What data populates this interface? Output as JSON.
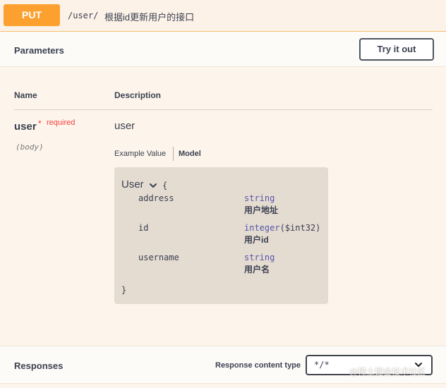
{
  "operation": {
    "method": "PUT",
    "path": "/user/",
    "summary": "根据id更新用户的接口"
  },
  "parameters": {
    "title": "Parameters",
    "try_button": "Try it out",
    "col_name": "Name",
    "col_description": "Description",
    "param": {
      "name": "user",
      "required_star": "*",
      "required_label": "required",
      "location": "(body)",
      "description": "user",
      "tab_example": "Example Value",
      "tab_model": "Model"
    }
  },
  "model": {
    "name": "User",
    "open_brace": "{",
    "close_brace": "}",
    "properties": [
      {
        "name": "address",
        "type": "string",
        "format": "",
        "description": "用户地址"
      },
      {
        "name": "id",
        "type": "integer",
        "format": "($int32)",
        "description": "用户id"
      },
      {
        "name": "username",
        "type": "string",
        "format": "",
        "description": "用户名"
      }
    ]
  },
  "responses": {
    "title": "Responses",
    "content_type_label": "Response content type",
    "content_type_value": "*/*"
  },
  "watermark": "@稀土掘金技术社区",
  "colors": {
    "put_accent": "#fca130",
    "required": "#f93e3e",
    "type": "#5555aa"
  },
  "icons": {
    "model_toggle": "chevron-down-icon",
    "select_arrow": "chevron-down-icon"
  }
}
